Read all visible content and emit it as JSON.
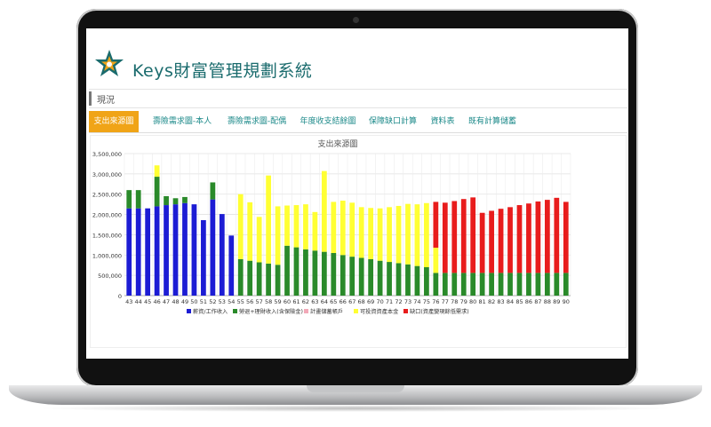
{
  "app": {
    "title": "Keys財富管理規劃系統"
  },
  "breadcrumb": {
    "text": "現況"
  },
  "tabs": [
    {
      "label": "支出來源圖",
      "active": true
    },
    {
      "label": "壽險需求圖-本人",
      "active": false
    },
    {
      "label": "壽險需求圖-配偶",
      "active": false
    },
    {
      "label": "年度收支結餘圖",
      "active": false
    },
    {
      "label": "保障缺口計算",
      "active": false
    },
    {
      "label": "資料表",
      "active": false
    },
    {
      "label": "既有計算儲蓄",
      "active": false
    }
  ],
  "colors": {
    "accent": "#f0a417",
    "brand": "#1a6b6d",
    "tab_text": "#1d8a8a"
  },
  "chart_data": {
    "type": "bar",
    "title": "支出來源圖",
    "stacked": true,
    "categories": [
      "43",
      "44",
      "45",
      "46",
      "47",
      "48",
      "49",
      "50",
      "51",
      "52",
      "53",
      "54",
      "55",
      "56",
      "57",
      "58",
      "59",
      "60",
      "61",
      "62",
      "63",
      "64",
      "65",
      "66",
      "67",
      "68",
      "69",
      "70",
      "71",
      "72",
      "73",
      "74",
      "75",
      "76",
      "77",
      "78",
      "79",
      "80",
      "81",
      "82",
      "83",
      "84",
      "85",
      "86",
      "87",
      "88",
      "89",
      "90"
    ],
    "ylim": [
      0,
      3500000
    ],
    "yticks": [
      "3,500,000",
      "3,000,000",
      "2,500,000",
      "2,000,000",
      "1,500,000",
      "1,000,000",
      "500,000",
      "0"
    ],
    "legend_position": "bottom",
    "series": [
      {
        "name": "薪資/工作收入",
        "color": "#1c1cd4",
        "values": [
          2150000,
          2150000,
          2150000,
          2200000,
          2230000,
          2250000,
          2280000,
          2250000,
          1860000,
          2370000,
          2010000,
          1480000,
          0,
          0,
          0,
          0,
          0,
          0,
          0,
          0,
          0,
          0,
          0,
          0,
          0,
          0,
          0,
          0,
          0,
          0,
          0,
          0,
          0,
          0,
          0,
          0,
          0,
          0,
          0,
          0,
          0,
          0,
          0,
          0,
          0,
          0,
          0,
          0
        ]
      },
      {
        "name": "勞退+理財收入(含保險金)",
        "color": "#2a8a2a",
        "values": [
          450000,
          450000,
          0,
          730000,
          220000,
          150000,
          150000,
          0,
          0,
          420000,
          0,
          0,
          900000,
          860000,
          820000,
          790000,
          760000,
          1230000,
          1190000,
          1140000,
          1110000,
          1080000,
          1050000,
          1000000,
          960000,
          930000,
          900000,
          860000,
          830000,
          800000,
          770000,
          730000,
          700000,
          560000,
          560000,
          560000,
          560000,
          560000,
          560000,
          560000,
          560000,
          560000,
          560000,
          560000,
          560000,
          560000,
          560000,
          560000
        ]
      },
      {
        "name": "計畫儲蓄帳戶",
        "color": "#f2a9b8",
        "values": [
          0,
          0,
          0,
          0,
          0,
          0,
          0,
          0,
          0,
          0,
          0,
          0,
          0,
          0,
          0,
          0,
          0,
          0,
          0,
          0,
          0,
          0,
          0,
          0,
          0,
          0,
          0,
          0,
          0,
          0,
          0,
          0,
          0,
          0,
          0,
          0,
          0,
          0,
          0,
          0,
          0,
          0,
          0,
          0,
          0,
          0,
          0,
          0
        ]
      },
      {
        "name": "可投資資產本金",
        "color": "#ffff33",
        "values": [
          0,
          0,
          0,
          280000,
          0,
          0,
          0,
          0,
          0,
          0,
          0,
          0,
          1600000,
          1440000,
          1120000,
          2170000,
          1440000,
          990000,
          1040000,
          1110000,
          950000,
          1990000,
          1260000,
          1340000,
          1330000,
          1250000,
          1260000,
          1290000,
          1350000,
          1410000,
          1490000,
          1520000,
          1580000,
          620000,
          0,
          0,
          0,
          0,
          0,
          0,
          0,
          0,
          0,
          0,
          0,
          0,
          0,
          0
        ]
      },
      {
        "name": "缺口(資產變現餘低需求)",
        "color": "#e81c1c",
        "values": [
          0,
          0,
          0,
          0,
          0,
          0,
          0,
          0,
          0,
          0,
          0,
          0,
          0,
          0,
          0,
          0,
          0,
          0,
          0,
          0,
          0,
          0,
          0,
          0,
          0,
          0,
          0,
          0,
          0,
          0,
          0,
          0,
          0,
          1130000,
          1730000,
          1770000,
          1820000,
          1860000,
          1480000,
          1530000,
          1580000,
          1620000,
          1670000,
          1710000,
          1760000,
          1800000,
          1850000,
          1750000
        ]
      }
    ]
  }
}
